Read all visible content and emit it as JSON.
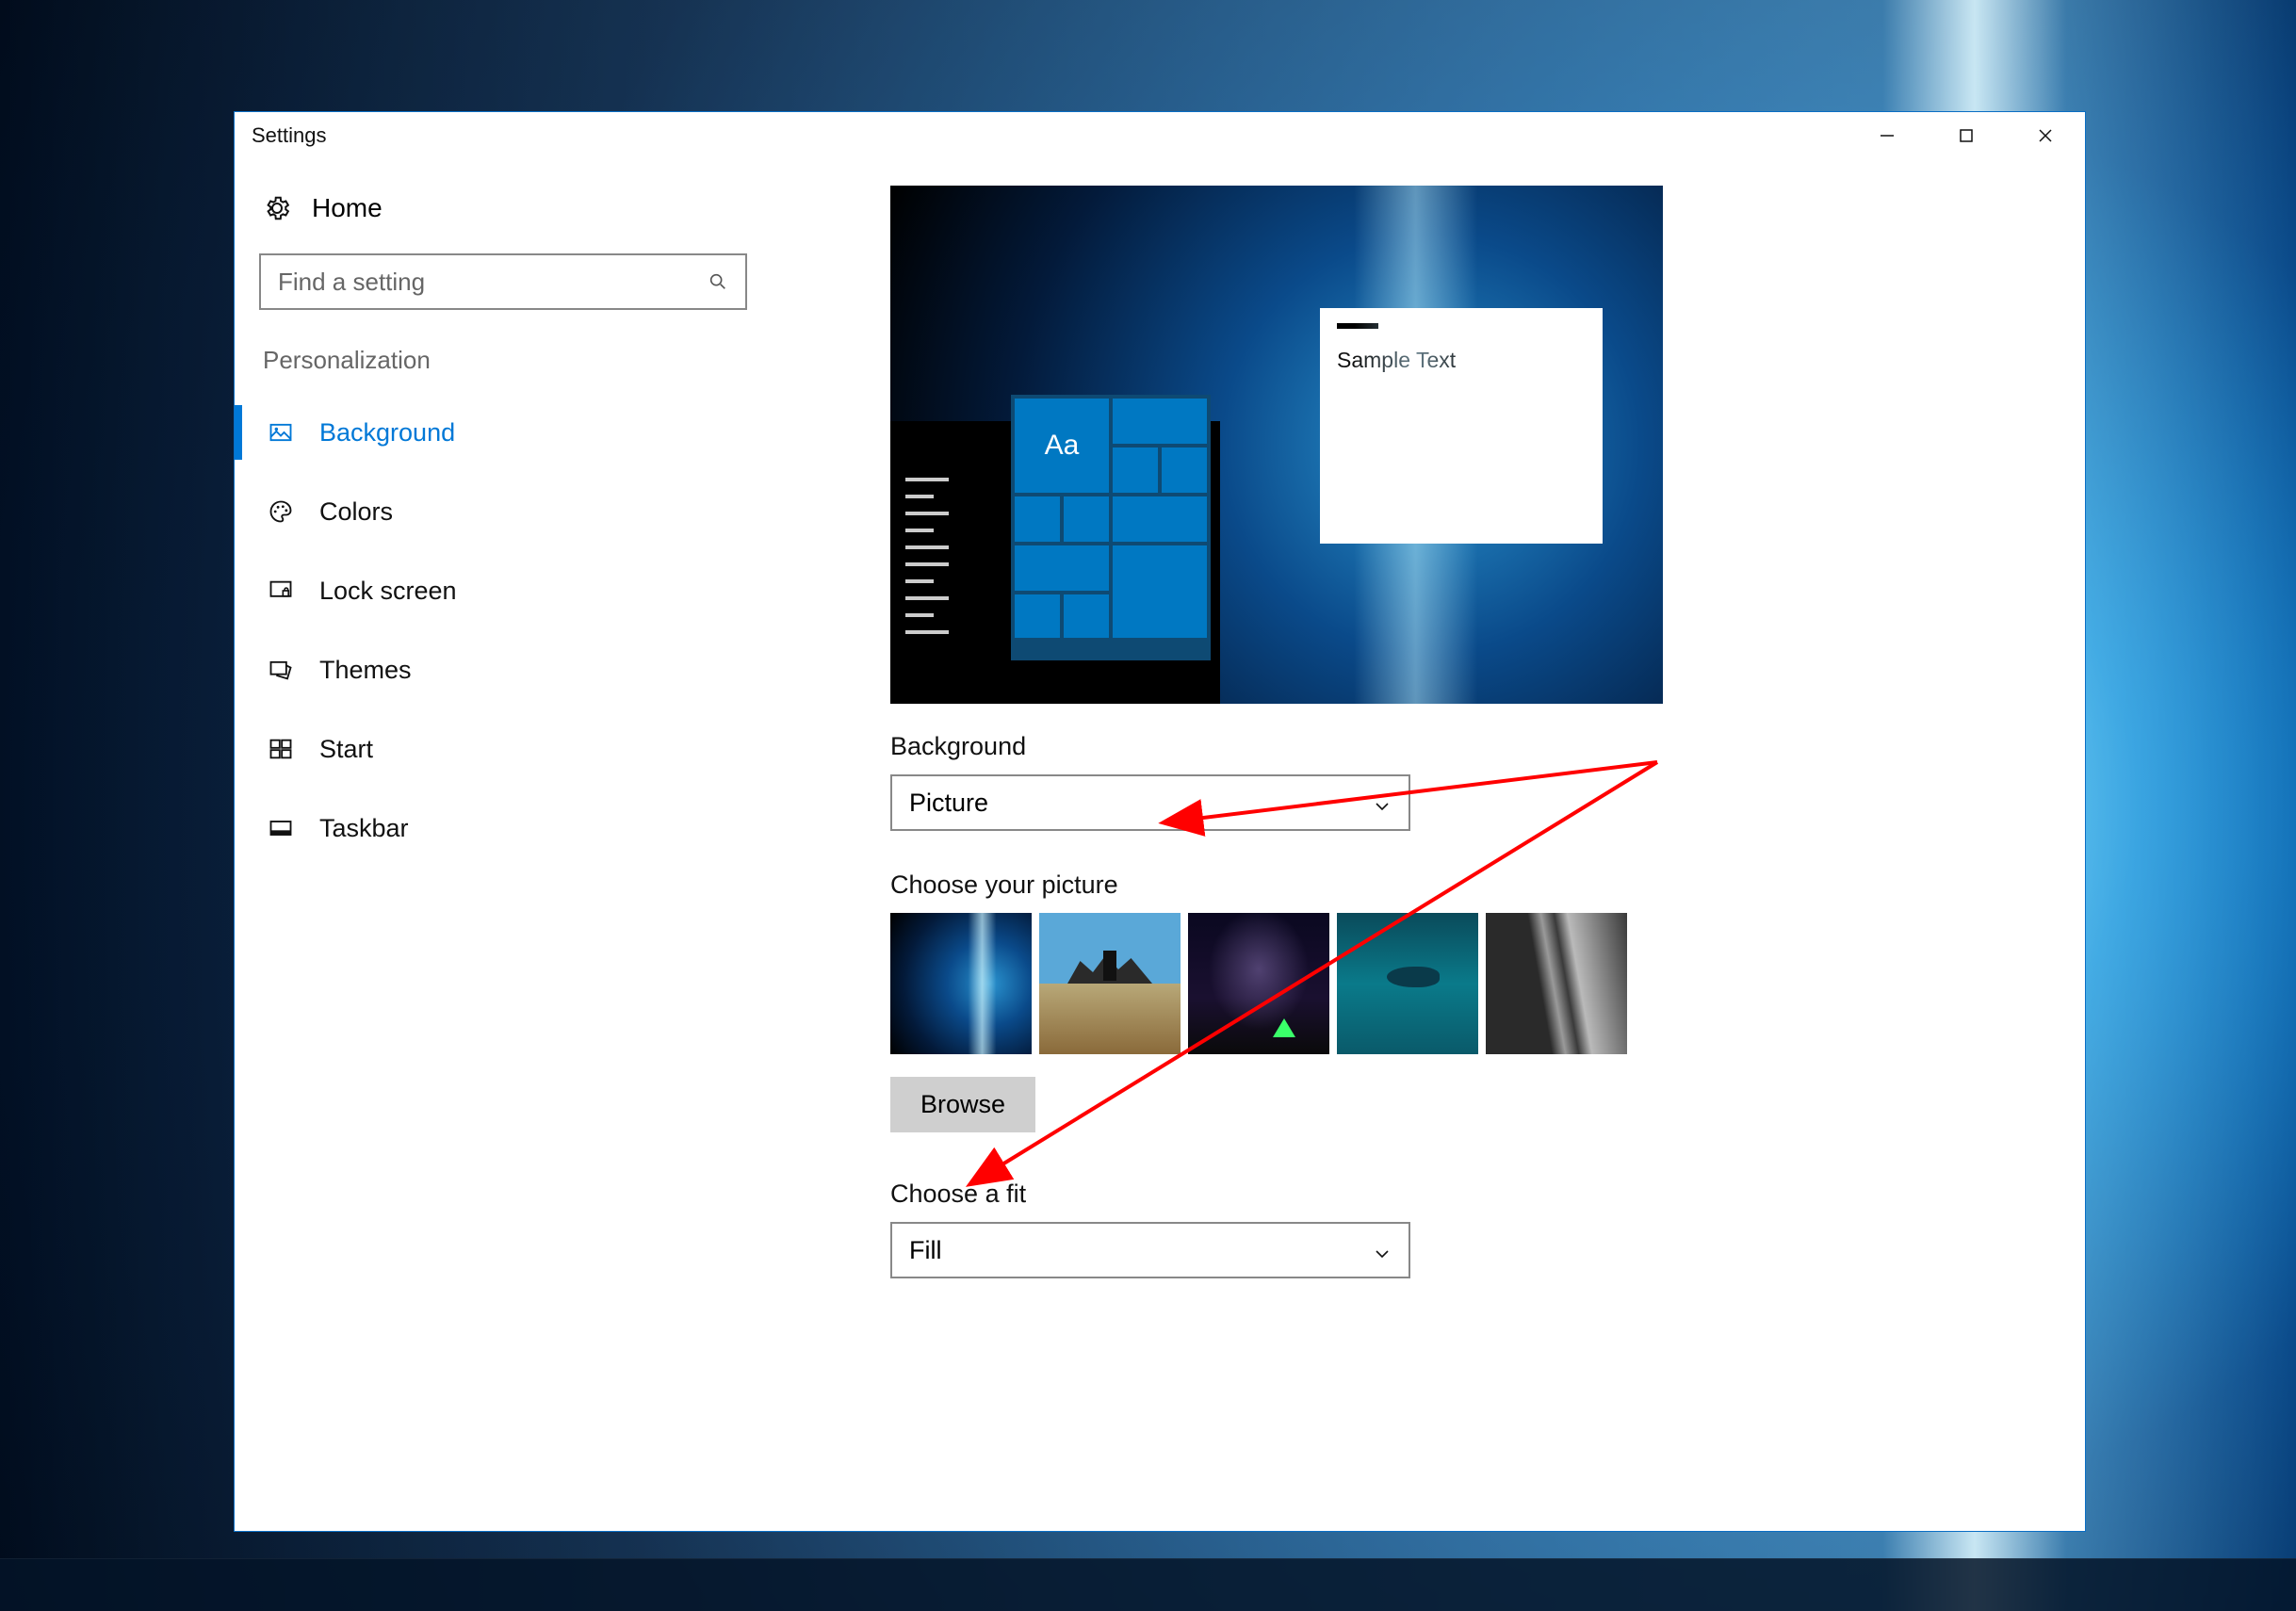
{
  "window": {
    "title": "Settings"
  },
  "sidebar": {
    "home_label": "Home",
    "search_placeholder": "Find a setting",
    "section": "Personalization",
    "items": [
      {
        "label": "Background",
        "selected": true
      },
      {
        "label": "Colors",
        "selected": false
      },
      {
        "label": "Lock screen",
        "selected": false
      },
      {
        "label": "Themes",
        "selected": false
      },
      {
        "label": "Start",
        "selected": false
      },
      {
        "label": "Taskbar",
        "selected": false
      }
    ]
  },
  "content": {
    "preview": {
      "tile_text": "Aa",
      "sample_text": "Sample Text"
    },
    "background_label": "Background",
    "background_value": "Picture",
    "choose_picture_label": "Choose your picture",
    "browse_label": "Browse",
    "fit_label": "Choose a fit",
    "fit_value": "Fill"
  }
}
